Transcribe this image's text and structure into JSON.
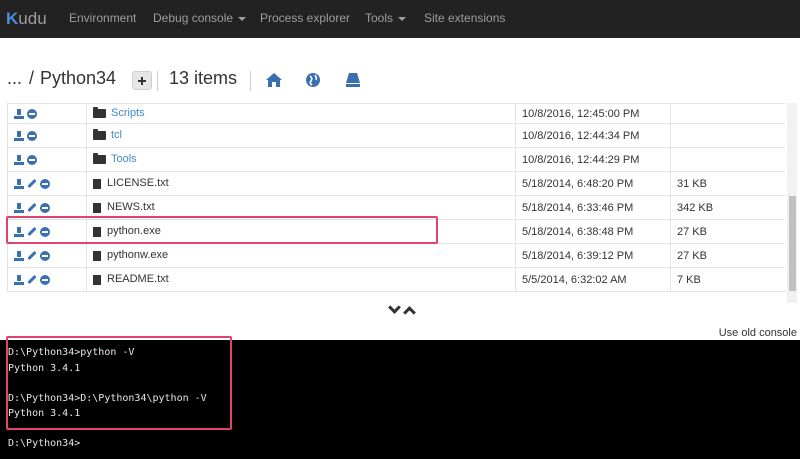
{
  "navbar": {
    "brand_prefix": "K",
    "brand_rest": "udu",
    "items": [
      {
        "label": "Environment",
        "dropdown": false
      },
      {
        "label": "Debug console",
        "dropdown": true
      },
      {
        "label": "Process explorer",
        "dropdown": false
      },
      {
        "label": "Tools",
        "dropdown": true
      },
      {
        "label": "Site extensions",
        "dropdown": false
      }
    ]
  },
  "header": {
    "ellipsis": "...",
    "slash": "/",
    "folder": "Python34",
    "item_count": "13 items",
    "icons": [
      "home-icon",
      "globe-icon",
      "drive-icon"
    ]
  },
  "files": {
    "rows": [
      {
        "name": "Scripts",
        "type": "folder",
        "modified": "10/8/2016, 12:45:00 PM",
        "size": "",
        "actions": [
          "download-icon",
          "delete-icon"
        ]
      },
      {
        "name": "tcl",
        "type": "folder",
        "modified": "10/8/2016, 12:44:34 PM",
        "size": "",
        "actions": [
          "download-icon",
          "delete-icon"
        ]
      },
      {
        "name": "Tools",
        "type": "folder",
        "modified": "10/8/2016, 12:44:29 PM",
        "size": "",
        "actions": [
          "download-icon",
          "delete-icon"
        ]
      },
      {
        "name": "LICENSE.txt",
        "type": "file",
        "modified": "5/18/2014, 6:48:20 PM",
        "size": "31 KB",
        "actions": [
          "download-icon",
          "edit-icon",
          "delete-icon"
        ]
      },
      {
        "name": "NEWS.txt",
        "type": "file",
        "modified": "5/18/2014, 6:33:46 PM",
        "size": "342 KB",
        "actions": [
          "download-icon",
          "edit-icon",
          "delete-icon"
        ]
      },
      {
        "name": "python.exe",
        "type": "file",
        "modified": "5/18/2014, 6:38:48 PM",
        "size": "27 KB",
        "actions": [
          "download-icon",
          "edit-icon",
          "delete-icon"
        ]
      },
      {
        "name": "pythonw.exe",
        "type": "file",
        "modified": "5/18/2014, 6:39:12 PM",
        "size": "27 KB",
        "actions": [
          "download-icon",
          "edit-icon",
          "delete-icon"
        ]
      },
      {
        "name": "README.txt",
        "type": "file",
        "modified": "5/5/2014, 6:32:02 AM",
        "size": "7 KB",
        "actions": [
          "download-icon",
          "edit-icon",
          "delete-icon"
        ]
      }
    ],
    "highlighted_row": "python.exe"
  },
  "console": {
    "old_console_link": "Use old console",
    "lines": [
      "D:\\Python34>python -V",
      "Python 3.4.1",
      "",
      "D:\\Python34>D:\\Python34\\python -V",
      "Python 3.4.1",
      "",
      "D:\\Python34>"
    ]
  },
  "colors": {
    "navbar_bg": "#222222",
    "link": "#428bca",
    "action_icon": "#3a6fb0",
    "highlight_box": "#e0436d",
    "console_bg": "#000000"
  }
}
